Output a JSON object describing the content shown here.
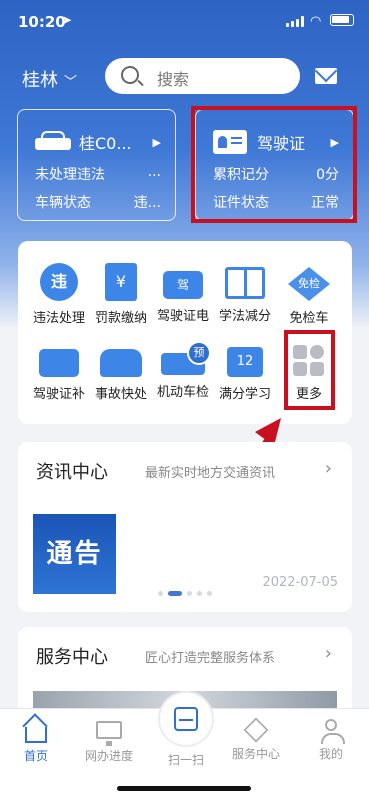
{
  "status_bar": {
    "time": "10:20",
    "location_icon": "location-arrow-icon"
  },
  "header": {
    "city": "桂林",
    "search_placeholder": "搜索"
  },
  "vehicle_card": {
    "plate": "桂C0...",
    "row1_label": "未处理违法",
    "row1_value": "...",
    "row2_label": "车辆状态",
    "row2_value": "违..."
  },
  "license_card": {
    "title": "驾驶证",
    "row1_label": "累积记分",
    "row1_value": "0分",
    "row2_label": "证件状态",
    "row2_value": "正常"
  },
  "services": [
    {
      "label": "违法处理",
      "icon": "violation-magnifier-icon",
      "glyph": "违"
    },
    {
      "label": "罚款缴纳",
      "icon": "fine-receipt-icon",
      "glyph": "¥"
    },
    {
      "label": "驾驶证电",
      "icon": "e-license-icon",
      "glyph": "驾"
    },
    {
      "label": "学法减分",
      "icon": "book-icon",
      "glyph": ""
    },
    {
      "label": "免检车",
      "icon": "inspection-exempt-icon",
      "glyph": "免检"
    },
    {
      "label": "驾驶证补",
      "icon": "license-replace-icon",
      "glyph": ""
    },
    {
      "label": "事故快处",
      "icon": "accident-icon",
      "glyph": ""
    },
    {
      "label": "机动车检",
      "icon": "vehicle-inspection-icon",
      "glyph": ""
    },
    {
      "label": "满分学习",
      "icon": "calendar-icon",
      "glyph": "12"
    },
    {
      "label": "更多",
      "icon": "more-grid-icon",
      "glyph": ""
    }
  ],
  "news": {
    "title": "资讯中心",
    "subtitle": "最新实时地方交通资讯",
    "image_text": "通告",
    "date": "2022-07-05"
  },
  "service_center": {
    "title": "服务中心",
    "subtitle": "匠心打造完整服务体系"
  },
  "tabbar": {
    "home": "首页",
    "progress": "网办进度",
    "scan": "扫一扫",
    "service": "服务中心",
    "mine": "我的"
  },
  "colors": {
    "brand": "#2f6fd0",
    "highlight": "#c8101e"
  }
}
